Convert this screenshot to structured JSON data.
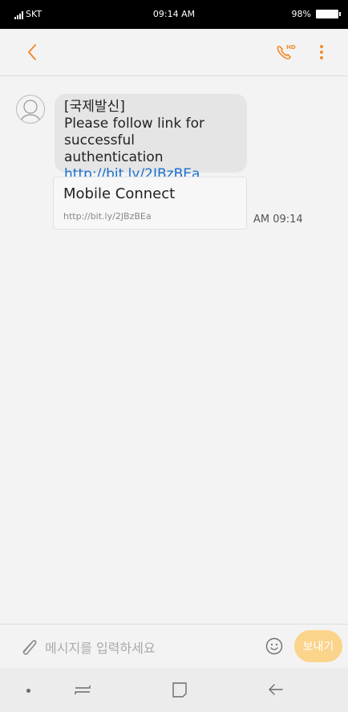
{
  "status_bar": {
    "carrier": "SKT",
    "time": "09:14 AM",
    "battery": "98%"
  },
  "toolbar": {
    "back_icon": "chevron-left-icon",
    "call_icon": "hd-call-icon",
    "more_icon": "more-vert-icon",
    "accent_color": "#f08c2c"
  },
  "message": {
    "lines": [
      "[국제발신]",
      "Please follow link for",
      "successful authentication"
    ],
    "link_text": "http://bit.ly/2JBzBEa",
    "preview_title": "Mobile Connect",
    "preview_url": "http://bit.ly/2JBzBEa",
    "time": "AM 09:14"
  },
  "composer": {
    "placeholder": "메시지를 입력하세요",
    "send_label": "보내기",
    "send_color": "#fbd48b"
  }
}
